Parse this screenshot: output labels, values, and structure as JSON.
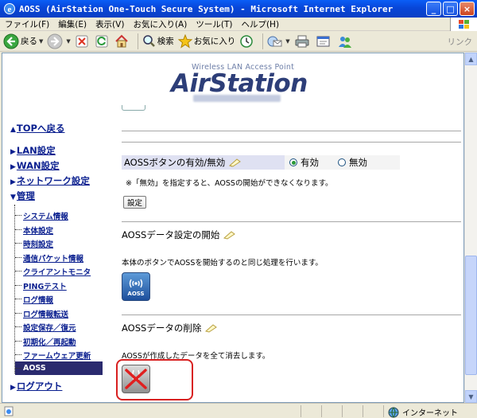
{
  "window": {
    "title": "AOSS (AirStation One-Touch Secure System) - Microsoft Internet Explorer",
    "controls": [
      "_",
      "□",
      "×"
    ]
  },
  "menubar": {
    "items": [
      "ファイル(F)",
      "編集(E)",
      "表示(V)",
      "お気に入り(A)",
      "ツール(T)",
      "ヘルプ(H)"
    ]
  },
  "toolbar": {
    "back": "戻る",
    "search": "検索",
    "favorites": "お気に入り",
    "links": "リンク"
  },
  "header": {
    "subtitle": "Wireless LAN Access Point",
    "brand": "AirStation"
  },
  "nav": {
    "top": "TOPへ戻る",
    "sections": [
      {
        "label": "LAN設定",
        "marker": "▶"
      },
      {
        "label": "WAN設定",
        "marker": "▶"
      },
      {
        "label": "ネットワーク設定",
        "marker": "▶"
      },
      {
        "label": "管理",
        "marker": "▼"
      }
    ],
    "sub_items": [
      "システム情報",
      "本体設定",
      "時刻設定",
      "通信パケット情報",
      "クライアントモニタ",
      "PINGテスト",
      "ログ情報",
      "ログ情報転送",
      "設定保存／復元",
      "初期化／再起動",
      "ファームウェア更新",
      "AOSS"
    ],
    "active_sub": "AOSS",
    "logout": "ログアウト"
  },
  "main": {
    "aoss_toggle": {
      "label": "AOSSボタンの有効/無効",
      "option_on": "有効",
      "option_off": "無効",
      "selected": "有効",
      "note": "※「無効」を指定すると、AOSSの開始ができなくなります。",
      "submit": "設定"
    },
    "start": {
      "title": "AOSSデータ設定の開始",
      "desc": "本体のボタンでAOSSを開始するのと同じ処理を行います。",
      "button_text": "AOSS"
    },
    "delete": {
      "title": "AOSSデータの削除",
      "desc": "AOSSが作成したデータを全て消去します。"
    }
  },
  "status": {
    "zone": "インターネット"
  },
  "colors": {
    "titlebar": "#0a4fe0",
    "nav_link": "#0a1f8f",
    "active_nav": "#2a2a6e",
    "highlight_frame": "#d82020",
    "brand": "#2d3e78"
  }
}
